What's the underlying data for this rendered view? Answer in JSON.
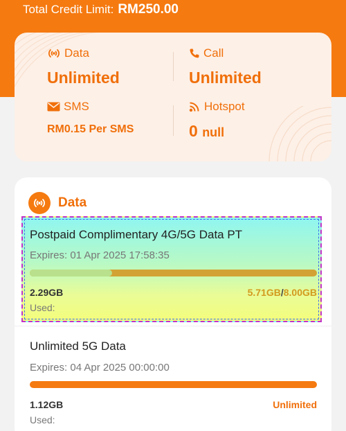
{
  "header": {
    "credit_label": "Total Credit Limit:",
    "credit_amount": "RM250.00"
  },
  "summary": {
    "data": {
      "label": "Data",
      "value": "Unlimited",
      "icon": "signal-icon"
    },
    "call": {
      "label": "Call",
      "value": "Unlimited",
      "icon": "phone-icon"
    },
    "sms": {
      "label": "SMS",
      "value": "RM0.15 Per SMS",
      "icon": "envelope-icon"
    },
    "hotspot": {
      "label": "Hotspot",
      "value_number": "0",
      "value_unit": "null",
      "icon": "hotspot-icon"
    }
  },
  "data_section": {
    "title": "Data",
    "icon": "signal-icon",
    "plans": [
      {
        "name": "Postpaid Complimentary 4G/5G Data PT",
        "expires": "Expires: 01 Apr 2025 17:58:35",
        "used": "2.29GB",
        "used_label": "Used:",
        "remaining": "5.71GB",
        "total_sep": "/",
        "total": "8.00GB",
        "used_fraction": 0.286
      },
      {
        "name": "Unlimited 5G Data",
        "expires": "Expires: 04 Apr 2025 00:00:00",
        "used": "1.12GB",
        "used_label": "Used:",
        "total": "Unlimited"
      }
    ]
  },
  "colors": {
    "brand_orange": "#f57a10",
    "accent_text": "#f06f0a",
    "bar_used": "#b9e08c",
    "bar_remaining": "#d3a234"
  }
}
